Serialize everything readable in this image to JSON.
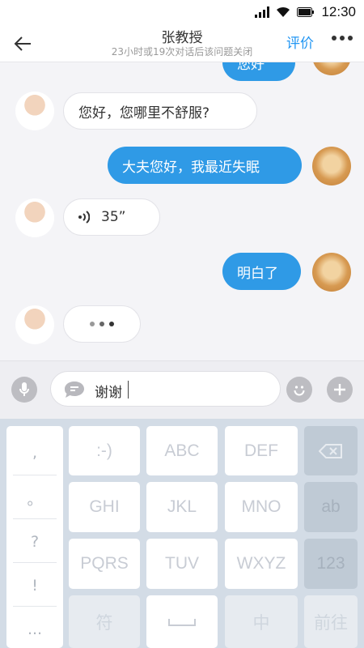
{
  "status": {
    "time": "12:30"
  },
  "nav": {
    "title": "张教授",
    "subtitle": "23小时或19次对话后该问题关闭",
    "rate_label": "评价"
  },
  "messages": [
    {
      "side": "right",
      "text": "您好"
    },
    {
      "side": "left",
      "text": "您好，您哪里不舒服?"
    },
    {
      "side": "right",
      "text": "大夫您好，我最近失眠"
    },
    {
      "side": "left",
      "text": "35”",
      "type": "voice"
    },
    {
      "side": "right",
      "text": "明白了"
    },
    {
      "side": "left",
      "text": "",
      "type": "typing"
    }
  ],
  "input": {
    "value": "谢谢"
  },
  "keyboard": {
    "punctuation": [
      ",",
      "。",
      "?",
      "!",
      "..."
    ],
    "keys": [
      [
        ":-)",
        "ABC",
        "DEF"
      ],
      [
        "GHI",
        "JKL",
        "MNO",
        "ab"
      ],
      [
        "PQRS",
        "TUV",
        "WXYZ",
        "123"
      ],
      [
        "符",
        "中",
        "前往"
      ]
    ]
  }
}
